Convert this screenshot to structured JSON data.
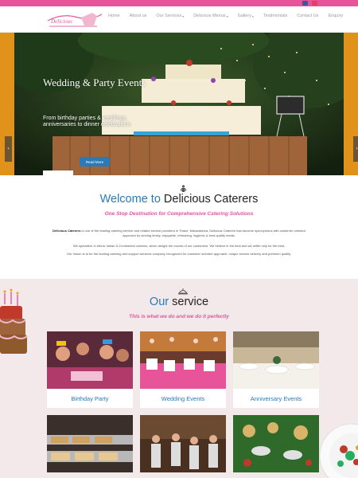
{
  "colors": {
    "brand_pink": "#e8549a",
    "brand_blue": "#2a7ab8",
    "hero_orange": "#e0921b"
  },
  "nav": {
    "items": [
      {
        "label": "Home",
        "dropdown": false
      },
      {
        "label": "About us",
        "dropdown": false
      },
      {
        "label": "Our Services",
        "dropdown": true
      },
      {
        "label": "Delicious Menus",
        "dropdown": true
      },
      {
        "label": "Gallery",
        "dropdown": true
      },
      {
        "label": "Testimonials",
        "dropdown": false
      },
      {
        "label": "Contact Us",
        "dropdown": false
      },
      {
        "label": "Enquiry",
        "dropdown": false
      }
    ]
  },
  "hero": {
    "title": "Wedding &  Party Events",
    "subtitle": "From birthday parties & weddings, anniversaries to dinner celebrations",
    "button": "Read More",
    "prev_icon": "chevron-left-icon",
    "next_icon": "chevron-right-icon"
  },
  "welcome": {
    "title_part1": "Welcome to",
    "title_part2": "Delicious Caterers",
    "tagline": "One Stop Destination for Comprehensive Catering Solutions",
    "p1_bold": "Delicious Caterers",
    "p1_rest": " is one of the leading catering service and related service providers in Thane, Maharashtra. Delicious Caterers has become synonymous with customer oriented approach by serving timely, enjoyable, refreshing, hygienic & best quality meals.",
    "p2": "We specialize in ethnic Indian & Continental cuisines, which delight the moods of our customers. We believe in the best and we settle only for the best.",
    "p3": "Our Vision is to be the leading catering and support services company recognized for customer oriented approach, unique service delivery and premium quality."
  },
  "services": {
    "title_part1": "Our",
    "title_part2": "service",
    "tagline": "This is what we do and we do it perfectly",
    "cards": [
      {
        "label": "Birthday Party"
      },
      {
        "label": "Wedding Events"
      },
      {
        "label": "Anniversary Events"
      },
      {
        "label": ""
      },
      {
        "label": ""
      },
      {
        "label": ""
      }
    ]
  }
}
